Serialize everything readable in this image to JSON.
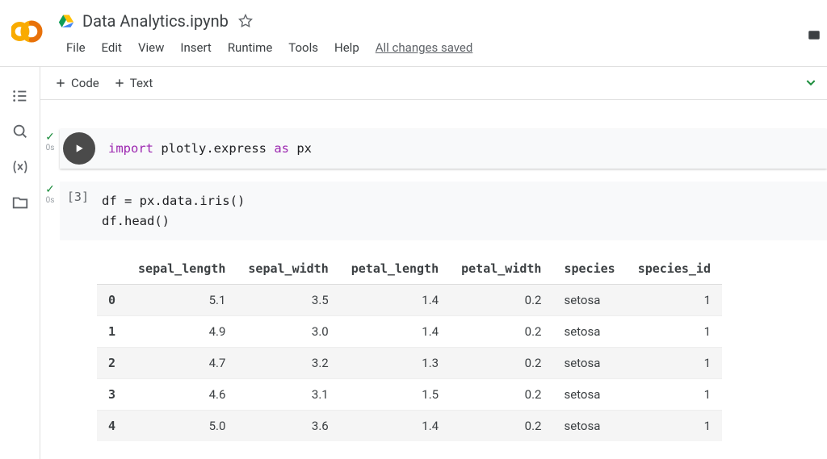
{
  "header": {
    "title": "Data Analytics.ipynb",
    "menus": [
      "File",
      "Edit",
      "View",
      "Insert",
      "Runtime",
      "Tools",
      "Help"
    ],
    "status": "All changes saved"
  },
  "toolbar": {
    "code_label": "Code",
    "text_label": "Text"
  },
  "cells": [
    {
      "status_time": "0s",
      "code": {
        "kw1": "import",
        "mid": " plotly.express ",
        "kw2": "as",
        "end": " px"
      }
    },
    {
      "exec_count": "[3]",
      "status_time": "0s",
      "code_plain": "df = px.data.iris()\ndf.head()"
    }
  ],
  "output": {
    "columns": [
      "",
      "sepal_length",
      "sepal_width",
      "petal_length",
      "petal_width",
      "species",
      "species_id"
    ],
    "rows": [
      {
        "idx": "0",
        "sepal_length": "5.1",
        "sepal_width": "3.5",
        "petal_length": "1.4",
        "petal_width": "0.2",
        "species": "setosa",
        "species_id": "1"
      },
      {
        "idx": "1",
        "sepal_length": "4.9",
        "sepal_width": "3.0",
        "petal_length": "1.4",
        "petal_width": "0.2",
        "species": "setosa",
        "species_id": "1"
      },
      {
        "idx": "2",
        "sepal_length": "4.7",
        "sepal_width": "3.2",
        "petal_length": "1.3",
        "petal_width": "0.2",
        "species": "setosa",
        "species_id": "1"
      },
      {
        "idx": "3",
        "sepal_length": "4.6",
        "sepal_width": "3.1",
        "petal_length": "1.5",
        "petal_width": "0.2",
        "species": "setosa",
        "species_id": "1"
      },
      {
        "idx": "4",
        "sepal_length": "5.0",
        "sepal_width": "3.6",
        "petal_length": "1.4",
        "petal_width": "0.2",
        "species": "setosa",
        "species_id": "1"
      }
    ]
  }
}
